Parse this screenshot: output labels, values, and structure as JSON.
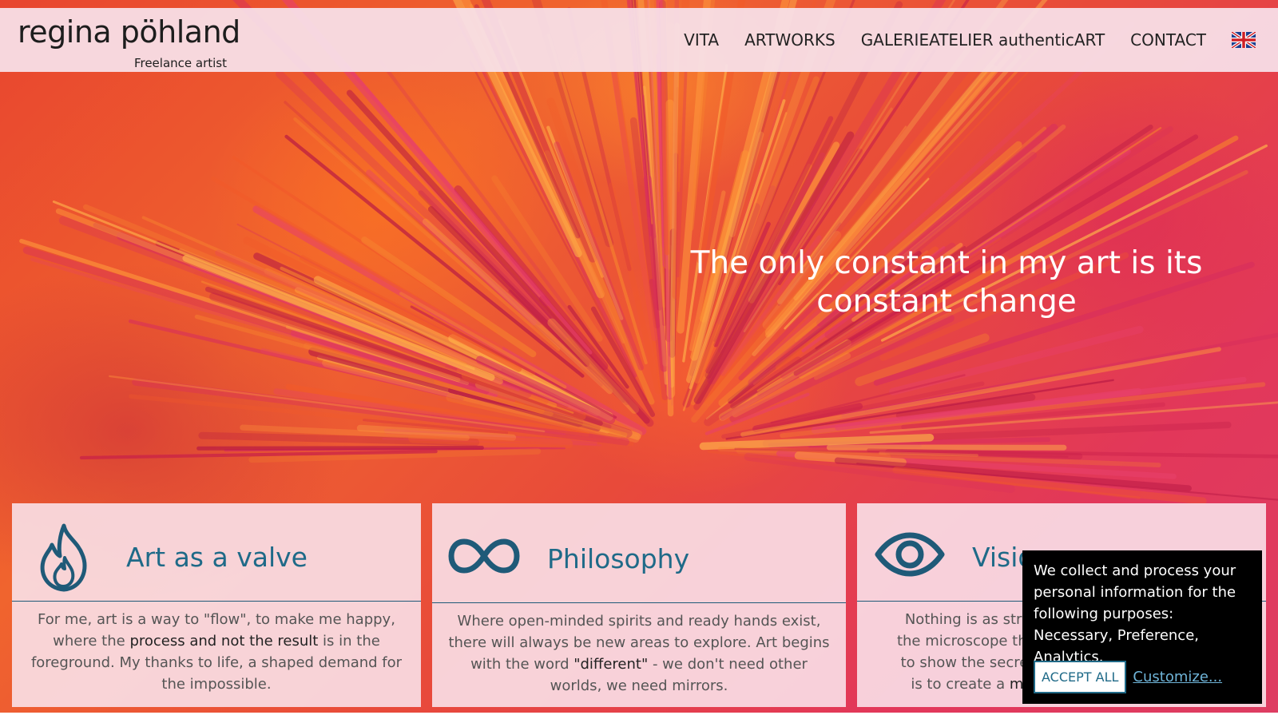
{
  "header": {
    "logo_name": "regina pöhland",
    "logo_subtitle": "Freelance artist",
    "nav": [
      {
        "label": "VITA"
      },
      {
        "label": "ARTWORKS"
      },
      {
        "label": "GALERIEATELIER authenticART"
      },
      {
        "label": "CONTACT"
      }
    ],
    "language_icon": "uk-flag-icon"
  },
  "hero": {
    "tagline": "The only constant in my art is its constant change"
  },
  "cards": [
    {
      "icon": "flame-icon",
      "title": "Art as a valve",
      "body": [
        {
          "text": "For me, art is a way to \"flow\", to make me happy, where the "
        },
        {
          "text": "process and not the result",
          "bold": true
        },
        {
          "text": " is in the foreground. My thanks to life, a shaped demand for the impossible."
        }
      ]
    },
    {
      "icon": "infinity-icon",
      "title": "Philosophy",
      "body": [
        {
          "text": "Where open-minded spirits and ready hands exist, there will always be new areas to explore. Art begins with the word "
        },
        {
          "text": "\"different\"",
          "bold": true
        },
        {
          "text": " - we don't need other worlds, we need mirrors."
        }
      ]
    },
    {
      "icon": "eye-icon",
      "title": "Visio",
      "body": [
        {
          "text": "Nothing is as strong as "
        },
        {
          "text": "the microscope that the"
        },
        {
          "text": "to show the secrets tha"
        },
        {
          "text": "is to create a "
        },
        {
          "text": "more hu",
          "bold": true
        }
      ]
    }
  ],
  "cookie": {
    "text": "We collect and process your personal information for the following purposes: ",
    "purposes": "Necessary, Preference, Analytics",
    "suffix": ".",
    "accept_label": "ACCEPT ALL",
    "customize_label": "Customize..."
  },
  "colors": {
    "accent": "#1f6a88",
    "hero_base": "#e8452f",
    "card_bg": "#fae1e9",
    "cookie_bg": "#000000"
  }
}
